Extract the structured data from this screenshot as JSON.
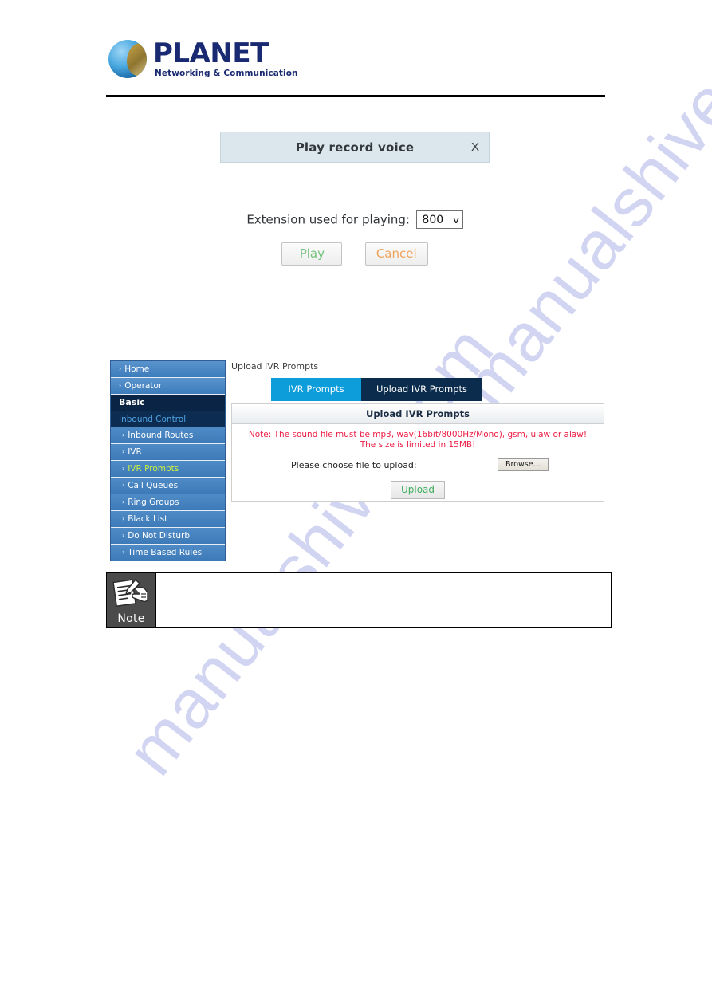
{
  "document": {
    "logo": {
      "wordmark": "PLANET",
      "tagline": "Networking & Communication"
    },
    "watermark": "manualshive.com"
  },
  "dialog": {
    "title": "Play record voice",
    "close_label": "X",
    "extension_label": "Extension used for playing:",
    "extension_value": "800",
    "extension_options": [
      "800"
    ],
    "caret": "∨",
    "play_label": "Play",
    "cancel_label": "Cancel",
    "colors": {
      "header_bg": "#dbe6ed",
      "play_text": "#72c17c",
      "cancel_text": "#efa35a"
    }
  },
  "webui": {
    "sidebar": {
      "top_items": [
        {
          "label": "Home",
          "arrow": "›"
        },
        {
          "label": "Operator",
          "arrow": "›"
        }
      ],
      "section_label": "Basic",
      "group_label": "Inbound Control",
      "sub_items": [
        {
          "label": "Inbound Routes",
          "arrow": "›",
          "active": false
        },
        {
          "label": "IVR",
          "arrow": "›",
          "active": false
        },
        {
          "label": "IVR Prompts",
          "arrow": "›",
          "active": true
        },
        {
          "label": "Call Queues",
          "arrow": "›",
          "active": false
        },
        {
          "label": "Ring Groups",
          "arrow": "›",
          "active": false
        },
        {
          "label": "Black List",
          "arrow": "›",
          "active": false
        },
        {
          "label": "Do Not Disturb",
          "arrow": "›",
          "active": false
        },
        {
          "label": "Time Based Rules",
          "arrow": "›",
          "active": false
        }
      ],
      "colors": {
        "item_bg": "#4080c0",
        "section_bg": "#0a2446",
        "group_bg": "#0c2c51",
        "group_text": "#4fa3e3",
        "active_text": "#ccf23c"
      }
    },
    "breadcrumb": "Upload IVR Prompts",
    "tabs": [
      {
        "label": "IVR Prompts",
        "active": false,
        "color": "#0d9ddb"
      },
      {
        "label": "Upload IVR Prompts",
        "active": true,
        "color": "#0b2c4d"
      }
    ],
    "panel": {
      "header": "Upload IVR Prompts",
      "note": "Note: The sound file must be mp3, wav(16bit/8000Hz/Mono), gsm, ulaw or alaw! The size is limited in 15MB!",
      "note_color": "#ed1c45",
      "upload_label": "Please choose file to upload:",
      "browse_label": "Browse...",
      "upload_button_label": "Upload",
      "upload_button_color": "#3fae5e"
    }
  },
  "note_box": {
    "icon_label": "Note",
    "body_text": ""
  }
}
